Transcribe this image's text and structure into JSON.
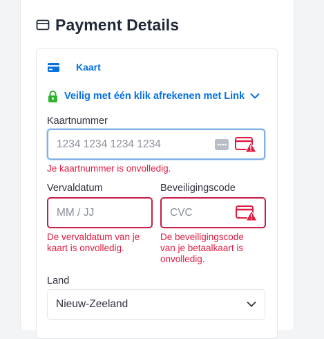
{
  "header": {
    "title": "Payment Details",
    "icon": "credit-card-outline-icon"
  },
  "payment_method": {
    "label": "Kaart",
    "icon": "credit-card-icon"
  },
  "link": {
    "label": "Veilig met één klik afrekenen met Link",
    "icon": "lock-icon",
    "chevron": "chevron-down-icon"
  },
  "card_number": {
    "label": "Kaartnummer",
    "placeholder": "1234 1234 1234 1234",
    "error": "Je kaartnummer is onvolledig."
  },
  "expiry": {
    "label": "Vervaldatum",
    "placeholder": "MM / JJ",
    "error_line1": "De vervaldatum van je",
    "error_line2": "kaart is onvolledig."
  },
  "cvc": {
    "label": "Beveiligingscode",
    "placeholder": "CVC",
    "error_line1": "De beveiligingscode",
    "error_line2": "van je betaalkaart is",
    "error_line3": "onvolledig."
  },
  "country": {
    "label": "Land",
    "value": "Nieuw-Zeeland"
  },
  "colors": {
    "accent": "#0570de",
    "error": "#df1b41",
    "success": "#30b130",
    "text": "#30313d"
  }
}
